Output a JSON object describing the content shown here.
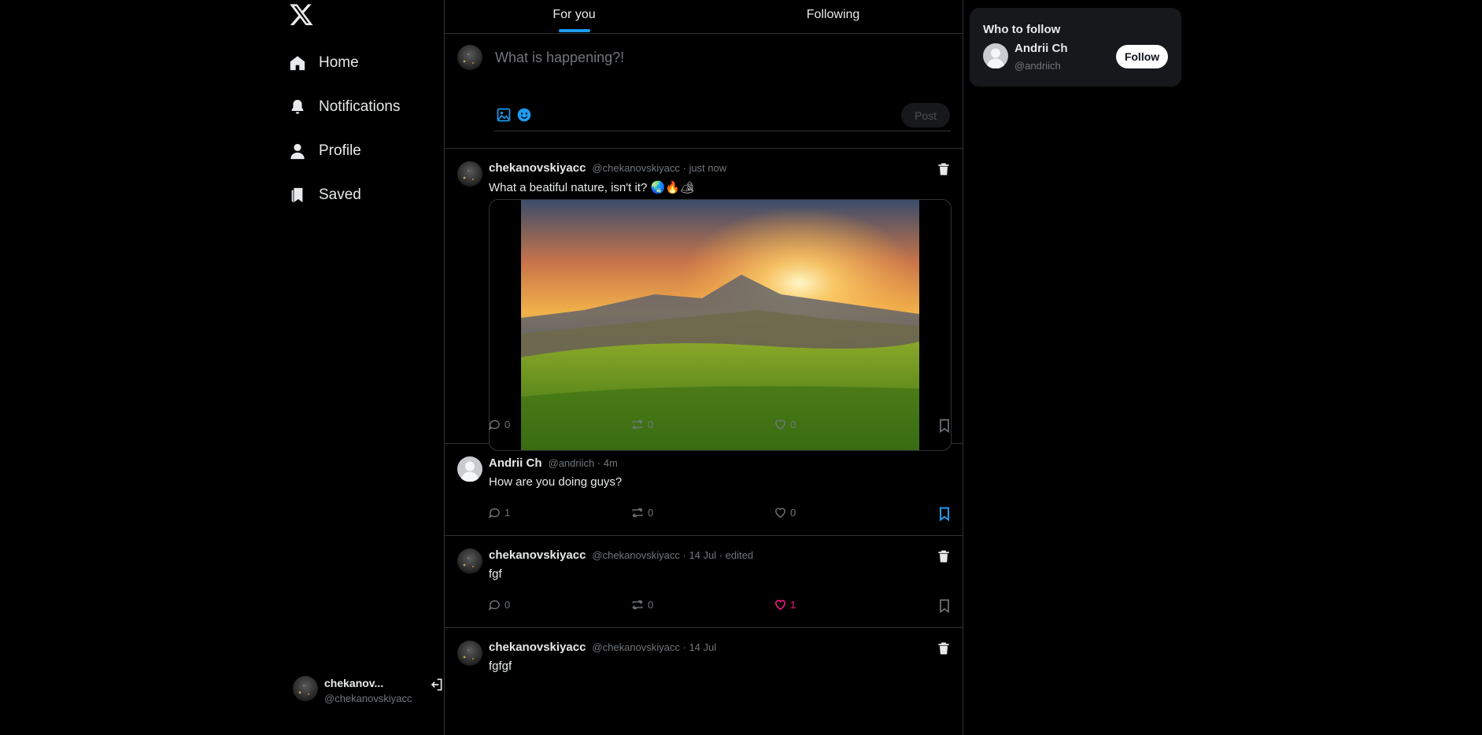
{
  "nav": {
    "items": [
      {
        "label": "Home",
        "icon": "home-icon"
      },
      {
        "label": "Notifications",
        "icon": "bell-icon"
      },
      {
        "label": "Profile",
        "icon": "user-icon"
      },
      {
        "label": "Saved",
        "icon": "bookmark-icon"
      }
    ]
  },
  "account": {
    "name": "chekanov...",
    "handle": "@chekanovskiyacc"
  },
  "tabs": [
    {
      "label": "For you",
      "active": true
    },
    {
      "label": "Following",
      "active": false
    }
  ],
  "composer": {
    "placeholder": "What is happening?!",
    "post_label": "Post"
  },
  "posts": [
    {
      "name": "chekanovskiyacc",
      "meta": "@chekanovskiyacc · just now",
      "text": "What a beatiful nature, isn't it? 🌏🔥🏕",
      "has_image": true,
      "deletable": true,
      "replies": "0",
      "reposts": "0",
      "likes": "0",
      "liked": false,
      "bookmarked": false
    },
    {
      "name": "Andrii Ch",
      "meta": "@andriich · 4m",
      "text": "How are you doing guys?",
      "has_image": false,
      "deletable": false,
      "replies": "1",
      "reposts": "0",
      "likes": "0",
      "liked": false,
      "bookmarked": true
    },
    {
      "name": "chekanovskiyacc",
      "meta": "@chekanovskiyacc · 14 Jul · edited",
      "text": "fgf",
      "has_image": false,
      "deletable": true,
      "replies": "0",
      "reposts": "0",
      "likes": "1",
      "liked": true,
      "bookmarked": false
    },
    {
      "name": "chekanovskiyacc",
      "meta": "@chekanovskiyacc · 14 Jul",
      "text": "fgfgf",
      "has_image": false,
      "deletable": true
    }
  ],
  "who_to_follow": {
    "title": "Who to follow",
    "users": [
      {
        "name": "Andrii Ch",
        "handle": "@andriich",
        "button": "Follow"
      }
    ]
  },
  "colors": {
    "accent": "#1d9bf0",
    "like": "#f91880",
    "background": "#000000",
    "border": "#2f3336",
    "muted": "#71767b"
  }
}
